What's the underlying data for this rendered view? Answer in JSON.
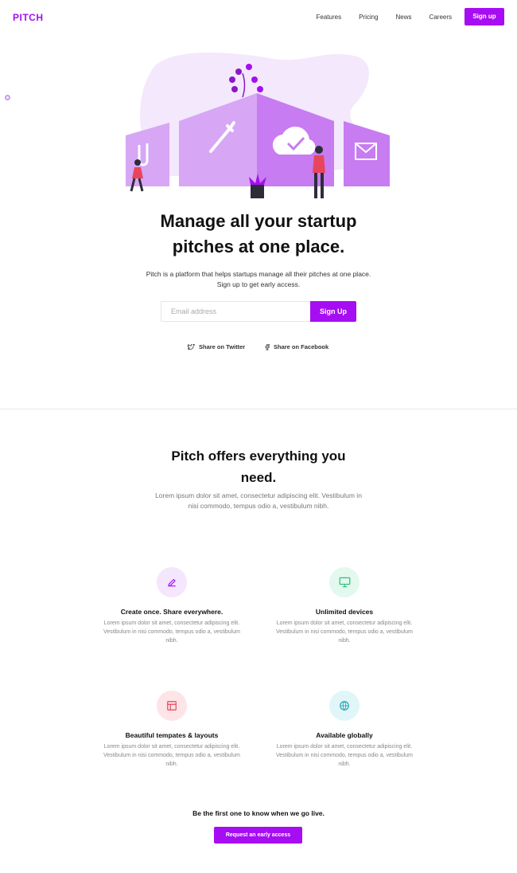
{
  "brand": {
    "logo": "PITCH",
    "accent": "#a60df2"
  },
  "nav": {
    "links": [
      "Features",
      "Pricing",
      "News",
      "Careers"
    ],
    "cta": "Sign up"
  },
  "hero": {
    "title_line1": "Manage all your startup",
    "title_line2": "pitches at one place.",
    "desc_line1": "Pitch is a platform that helps startups manage all their pitches at one place.",
    "desc_line2": "Sign up to get early access.",
    "email_placeholder": "Email address",
    "signup_label": "Sign Up",
    "share_twitter": "Share on Twitter",
    "share_facebook": "Share on Facebook"
  },
  "features": {
    "title_line1": "Pitch offers everything you",
    "title_line2": "need.",
    "desc": "Lorem ipsum dolor sit amet, consectetur adipiscing elit. Vestibulum in nisi commodo, tempus odio a, vestibulum nibh.",
    "items": [
      {
        "title": "Create once. Share everywhere.",
        "icon": "pencil-icon",
        "color": "#a60df2",
        "bg": "#f3e6fd",
        "text": "Lorem ipsum dolor sit amet, consectetur adipiscing elit. Vestibulum in nisi commodo, tempus odio a, vestibulum nibh."
      },
      {
        "title": "Unlimited devices",
        "icon": "monitor-icon",
        "color": "#2ec27e",
        "bg": "#e3f8ee",
        "text": "Lorem ipsum dolor sit amet, consectetur adipiscing elit. Vestibulum in nisi commodo, tempus odio a, vestibulum nibh."
      },
      {
        "title": "Beautiful tempates & layouts",
        "icon": "layout-icon",
        "color": "#e8455c",
        "bg": "#fde4e7",
        "text": "Lorem ipsum dolor sit amet, consectetur adipiscing elit. Vestibulum in nisi commodo, tempus odio a, vestibulum nibh."
      },
      {
        "title": "Available globally",
        "icon": "globe-icon",
        "color": "#1aa6b7",
        "bg": "#e1f6f8",
        "text": "Lorem ipsum dolor sit amet, consectetur adipiscing elit. Vestibulum in nisi commodo, tempus odio a, vestibulum nibh."
      }
    ]
  },
  "cta": {
    "text": "Be the first one to know when we go live.",
    "button": "Request an early access"
  }
}
